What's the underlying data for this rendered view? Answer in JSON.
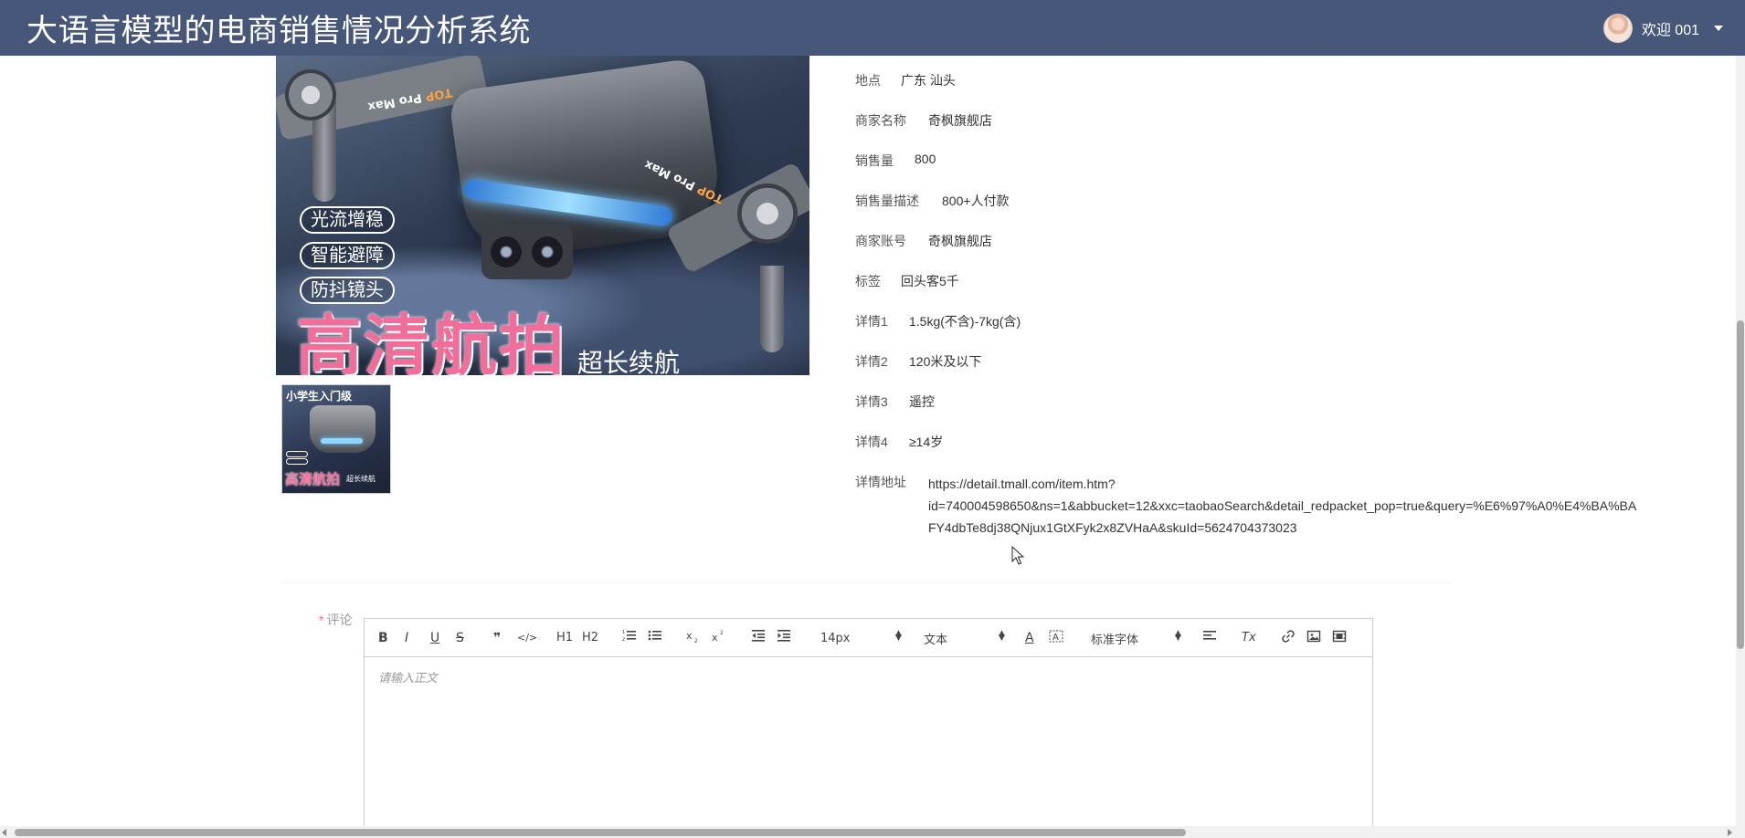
{
  "header": {
    "title": "大语言模型的电商销售情况分析系统",
    "welcome": "欢迎 001"
  },
  "image": {
    "model_text_a": "TOP",
    "model_text_b": "Pro Max",
    "features": [
      "光流增稳",
      "智能避障",
      "防抖镜头"
    ],
    "headline": "高清航拍",
    "subline": "超长续航",
    "thumb_top": "小学生入门级",
    "thumb_headline": "高清航拍",
    "thumb_subline": "超长续航"
  },
  "details": {
    "location": {
      "label": "地点",
      "value": "广东 汕头"
    },
    "shop_name": {
      "label": "商家名称",
      "value": "奇枫旗舰店"
    },
    "sales": {
      "label": "销售量",
      "value": "800"
    },
    "sales_desc": {
      "label": "销售量描述",
      "value": "800+人付款"
    },
    "shop_account": {
      "label": "商家账号",
      "value": "奇枫旗舰店"
    },
    "tag": {
      "label": "标签",
      "value": "回头客5千"
    },
    "detail1": {
      "label": "详情1",
      "value": "1.5kg(不含)-7kg(含)"
    },
    "detail2": {
      "label": "详情2",
      "value": "120米及以下"
    },
    "detail3": {
      "label": "详情3",
      "value": "遥控"
    },
    "detail4": {
      "label": "详情4",
      "value": "≥14岁"
    },
    "url": {
      "label": "详情地址",
      "line1": "https://detail.tmall.com/item.htm?",
      "line2": "id=740004598650&ns=1&abbucket=12&xxc=taobaoSearch&detail_redpacket_pop=true&query=%E6%97%A0%E4%BA%BA",
      "line3": "FY4dbTe8dj38QNjux1GtXFyk2x8ZVHaA&skuId=5624704373023"
    }
  },
  "comment": {
    "required_mark": "*",
    "label": "评论",
    "placeholder": "请输入正文",
    "toolbar": {
      "bold": "B",
      "italic": "I",
      "underline": "U",
      "strike": "S",
      "blockquote": "❞",
      "code": "</>",
      "h1": "H1",
      "h2": "H2",
      "font_size": "14px",
      "block_type": "文本",
      "font_family": "标准字体",
      "color": "A",
      "clean": "Tx"
    }
  }
}
